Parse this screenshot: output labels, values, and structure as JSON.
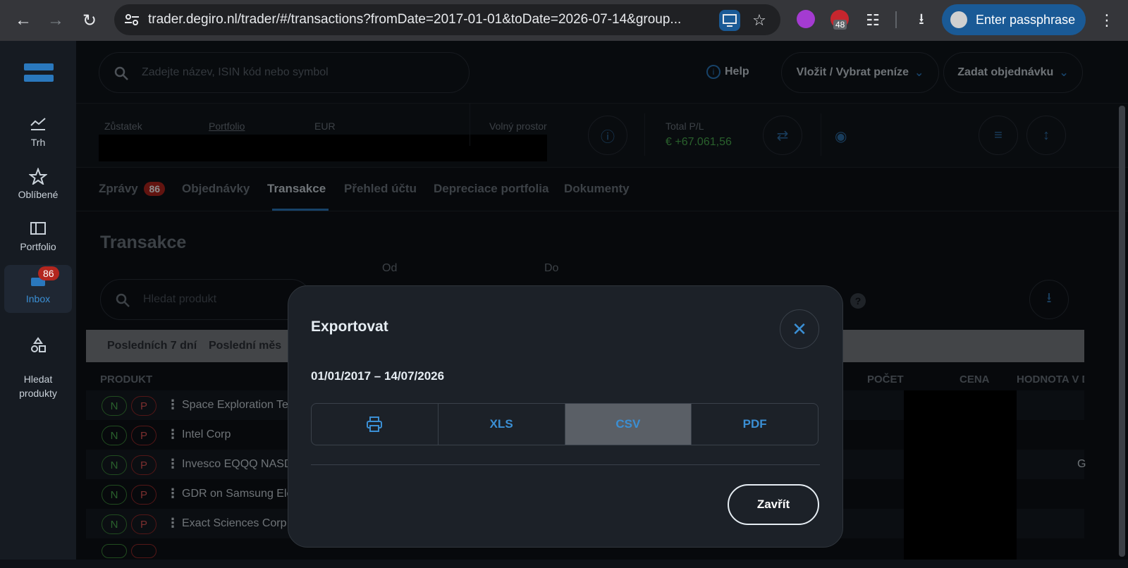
{
  "browser": {
    "url": "trader.degiro.nl/trader/#/transactions?fromDate=2017-01-01&toDate=2026-07-14&group...",
    "extension_badge": "48",
    "profile_button": "Enter passphrase"
  },
  "rail": {
    "items": [
      {
        "label": "Trh",
        "icon": "market-chart-icon"
      },
      {
        "label": "Oblíbené",
        "icon": "star-icon"
      },
      {
        "label": "Portfolio",
        "icon": "portfolio-icon"
      },
      {
        "label": "Inbox",
        "icon": "inbox-icon",
        "badge": "86",
        "active": true
      },
      {
        "label": "Hledat\nprodukty",
        "icon": "shapes-icon"
      }
    ]
  },
  "topbar": {
    "search_placeholder": "Zadejte název, ISIN kód nebo symbol",
    "help": "Help",
    "deposit": "Vložit / Vybrat peníze",
    "order": "Zadat objednávku"
  },
  "summary": {
    "balance_label": "Zůstatek",
    "portfolio_label": "Portfolio",
    "currency_label": "EUR",
    "free_space_label": "Volný prostor",
    "total_pl_label": "Total P/L",
    "total_pl_value": "€ +67.061,56",
    "pl_color": "#4caf50"
  },
  "tabs": [
    {
      "label": "Zprávy",
      "badge": "86"
    },
    {
      "label": "Objednávky"
    },
    {
      "label": "Transakce",
      "active": true
    },
    {
      "label": "Přehled účtu"
    },
    {
      "label": "Depreciace portfolia"
    },
    {
      "label": "Dokumenty"
    }
  ],
  "page": {
    "title": "Transakce",
    "from_label": "Od",
    "to_label": "Do",
    "product_search_placeholder": "Hledat produkt",
    "periods": [
      "Posledních 7 dní",
      "Poslední měs"
    ],
    "columns": [
      "PRODUKT",
      "POČET",
      "CENA",
      "HODNOTA V D"
    ],
    "rows": [
      {
        "name": "Space Exploration Te"
      },
      {
        "name": "Intel Corp"
      },
      {
        "name": "Invesco EQQQ NASD"
      },
      {
        "name": "GDR on Samsung Ele"
      },
      {
        "name": "Exact Sciences Corp"
      }
    ],
    "buy_label": "N",
    "sell_label": "P",
    "partial_cell": "G"
  },
  "modal": {
    "title": "Exportovat",
    "date_range": "01/01/2017 – 14/07/2026",
    "formats": [
      "XLS",
      "CSV",
      "PDF"
    ],
    "selected_format": "CSV",
    "close_button": "Zavřít"
  },
  "colors": {
    "accent": "#3b8fd4",
    "badge": "#b3261e",
    "buy": "#4caf50",
    "sell": "#e05555"
  }
}
